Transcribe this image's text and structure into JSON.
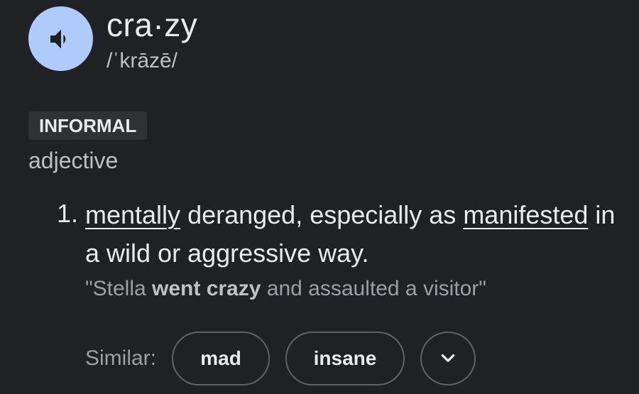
{
  "header": {
    "word": "cra·zy",
    "phonetic": "/ˈkrāzē/",
    "speaker_icon": "volume-up-icon"
  },
  "sense": {
    "register": "INFORMAL",
    "part_of_speech": "adjective",
    "number": "1.",
    "definition": {
      "link1": "mentally",
      "text1": " deranged, especially as ",
      "link2": "manifested",
      "text2": " in a wild or aggressive way."
    },
    "example": {
      "open": "\"Stella ",
      "bold": "went crazy",
      "close": " and assaulted a visitor\""
    }
  },
  "similar": {
    "label": "Similar:",
    "chips": [
      "mad",
      "insane"
    ],
    "more_icon": "chevron-down-icon"
  },
  "colors": {
    "background": "#202124",
    "speaker_bg": "#aecbfa",
    "text_primary": "#e8eaed",
    "text_secondary": "#9aa0a6"
  }
}
